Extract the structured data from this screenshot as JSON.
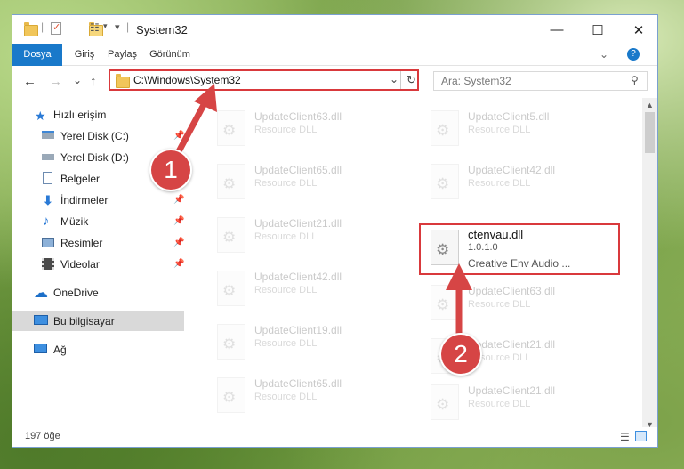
{
  "window": {
    "title": "System32"
  },
  "window_controls": {
    "minimize": "—",
    "maximize": "☐",
    "close": "✕"
  },
  "ribbon": {
    "tabs": [
      {
        "label": "Dosya"
      },
      {
        "label": "Giriş"
      },
      {
        "label": "Paylaş"
      },
      {
        "label": "Görünüm"
      }
    ],
    "help": "?"
  },
  "navigation": {
    "back": "←",
    "forward": "→",
    "recent": "⌄",
    "up": "↑",
    "address": "C:\\Windows\\System32",
    "dropdown": "⌄",
    "refresh": "↻",
    "search_placeholder": "Ara: System32"
  },
  "sidebar": {
    "items": [
      {
        "label": "Hızlı erişim"
      },
      {
        "label": "Yerel Disk (C:)",
        "pinned": true
      },
      {
        "label": "Yerel Disk (D:)",
        "pinned": true
      },
      {
        "label": "Belgeler",
        "pinned": true
      },
      {
        "label": "İndirmeler",
        "pinned": true
      },
      {
        "label": "Müzik",
        "pinned": true
      },
      {
        "label": "Resimler",
        "pinned": true
      },
      {
        "label": "Videolar",
        "pinned": true
      },
      {
        "label": "OneDrive"
      },
      {
        "label": "Bu bilgisayar",
        "selected": true
      },
      {
        "label": "Ağ"
      }
    ]
  },
  "files": {
    "left": [
      {
        "name": "UpdateClient63.dll",
        "type": "Resource DLL"
      },
      {
        "name": "UpdateClient65.dll",
        "type": "Resource DLL"
      },
      {
        "name": "UpdateClient21.dll",
        "type": "Resource DLL"
      },
      {
        "name": "UpdateClient42.dll",
        "type": "Resource DLL"
      },
      {
        "name": "UpdateClient19.dll",
        "type": "Resource DLL"
      },
      {
        "name": "UpdateClient65.dll",
        "type": "Resource DLL"
      }
    ],
    "right": [
      {
        "name": "UpdateClient5.dll",
        "type": "Resource DLL"
      },
      {
        "name": "UpdateClient42.dll",
        "type": "Resource DLL"
      },
      {
        "name": "ctenvau.dll",
        "type": "1.0.1.0",
        "description": "Creative Env Audio ..."
      },
      {
        "name": "UpdateClient63.dll",
        "type": "Resource DLL"
      },
      {
        "name": "UpdateClient21.dll",
        "type": "Resource DLL"
      },
      {
        "name": "UpdateClient21.dll",
        "type": "Resource DLL"
      }
    ]
  },
  "status": {
    "item_count": "197 öğe"
  },
  "annotations": {
    "marker_1": "1",
    "marker_2": "2"
  },
  "colors": {
    "accent": "#1979ca",
    "highlight": "#d9393c",
    "selection": "#d9d9d9"
  }
}
